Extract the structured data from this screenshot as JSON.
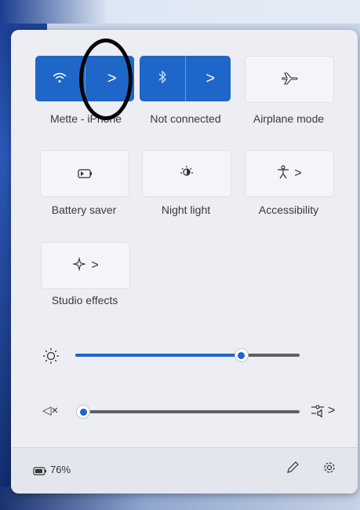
{
  "tiles": {
    "wifi": {
      "icon": "wifi-icon",
      "label": "Mette - iPhone",
      "chevron": ">"
    },
    "bluetooth": {
      "icon": "bluetooth-icon",
      "label": "Not connected",
      "chevron": ">"
    },
    "airplane": {
      "icon": "airplane-icon",
      "label": "Airplane mode"
    },
    "battery_saver": {
      "icon": "battery-saver-icon",
      "label": "Battery saver"
    },
    "night_light": {
      "icon": "night-light-icon",
      "label": "Night light"
    },
    "accessibility": {
      "icon": "accessibility-icon",
      "label": "Accessibility",
      "chevron": ">"
    },
    "studio_effects": {
      "icon": "studio-effects-icon",
      "label": "Studio effects",
      "chevron": ">"
    }
  },
  "sliders": {
    "brightness": {
      "icon": "brightness-icon",
      "level": 0.74
    },
    "volume": {
      "icon": "volume-muted-icon",
      "level": 0.0,
      "glyph": "◁×",
      "output_icon": "audio-output-icon",
      "chevron": ">"
    }
  },
  "footer": {
    "battery_icon": "battery-icon",
    "battery_percent": "76%",
    "edit_icon": "pencil-icon",
    "settings_icon": "gear-icon"
  },
  "colors": {
    "accent": "#1f66c9",
    "panel": "#eceef3",
    "annotation": "#050505"
  }
}
